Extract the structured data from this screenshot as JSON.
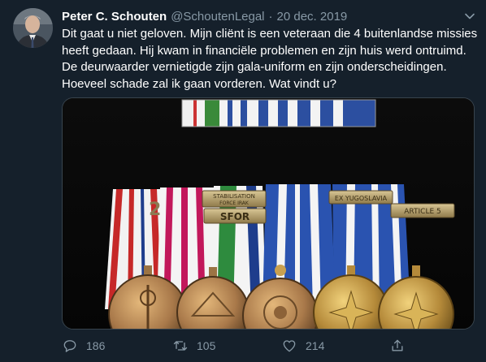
{
  "tweet": {
    "author_name": "Peter C. Schouten",
    "handle": "@SchoutenLegal",
    "separator": "·",
    "date": "20 dec. 2019",
    "text": "Dit gaat u niet geloven. Mijn cliënt is een veteraan die 4 buitenlandse missies heeft gedaan. Hij kwam in financiële problemen en zijn huis werd ontruimd. De deurwaarder vernietigde zijn gala-uniform en zijn onderscheidingen. Hoeveel schade zal ik gaan vorderen. Wat vindt u?",
    "media": {
      "clasp_stabilisation_line1": "STABILISATION",
      "clasp_stabilisation_line2": "FORCE IRAK",
      "clasp_sfor": "SFOR",
      "clasp_yugoslavia": "EX YUGOSLAVIA",
      "clasp_article5": "ARTICLE 5",
      "numeral_2": "2"
    },
    "actions": {
      "replies": "186",
      "retweets": "105",
      "likes": "214"
    }
  },
  "colors": {
    "background": "#15202b",
    "secondary_text": "#8899a6",
    "border": "#38444d"
  },
  "icons": [
    "chevron-down-icon",
    "reply-icon",
    "retweet-icon",
    "like-icon",
    "share-icon"
  ]
}
